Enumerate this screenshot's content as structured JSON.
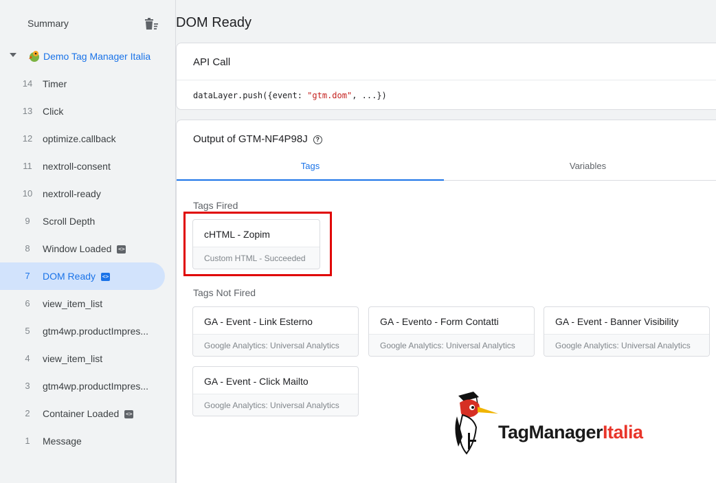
{
  "sidebar": {
    "summary_label": "Summary",
    "container_label": "Demo Tag Manager Italia",
    "events": [
      {
        "num": "14",
        "name": "Timer",
        "badge": false,
        "active": false
      },
      {
        "num": "13",
        "name": "Click",
        "badge": false,
        "active": false
      },
      {
        "num": "12",
        "name": "optimize.callback",
        "badge": false,
        "active": false
      },
      {
        "num": "11",
        "name": "nextroll-consent",
        "badge": false,
        "active": false
      },
      {
        "num": "10",
        "name": "nextroll-ready",
        "badge": false,
        "active": false
      },
      {
        "num": "9",
        "name": "Scroll Depth",
        "badge": false,
        "active": false
      },
      {
        "num": "8",
        "name": "Window Loaded",
        "badge": true,
        "active": false
      },
      {
        "num": "7",
        "name": "DOM Ready",
        "badge": true,
        "active": true
      },
      {
        "num": "6",
        "name": "view_item_list",
        "badge": false,
        "active": false
      },
      {
        "num": "5",
        "name": "gtm4wp.productImpres...",
        "badge": false,
        "active": false
      },
      {
        "num": "4",
        "name": "view_item_list",
        "badge": false,
        "active": false
      },
      {
        "num": "3",
        "name": "gtm4wp.productImpres...",
        "badge": false,
        "active": false
      },
      {
        "num": "2",
        "name": "Container Loaded",
        "badge": true,
        "active": false
      },
      {
        "num": "1",
        "name": "Message",
        "badge": false,
        "active": false
      }
    ]
  },
  "main": {
    "title": "DOM Ready",
    "api_call": {
      "title": "API Call",
      "code_prefix": "dataLayer.push({event: ",
      "code_string": "\"gtm.dom\"",
      "code_suffix": ", ...})"
    },
    "output": {
      "title": "Output of GTM-NF4P98J",
      "tabs": [
        {
          "label": "Tags",
          "active": true
        },
        {
          "label": "Variables",
          "active": false
        }
      ],
      "tags_fired_label": "Tags Fired",
      "tags_fired": [
        {
          "name": "cHTML - Zopim",
          "type": "Custom HTML - Succeeded"
        }
      ],
      "tags_not_fired_label": "Tags Not Fired",
      "tags_not_fired": [
        {
          "name": "GA - Event - Link Esterno",
          "type": "Google Analytics: Universal Analytics"
        },
        {
          "name": "GA - Evento - Form Contatti",
          "type": "Google Analytics: Universal Analytics"
        },
        {
          "name": "GA - Event - Banner Visibility",
          "type": "Google Analytics: Universal Analytics"
        },
        {
          "name": "GA - Event - Click Mailto",
          "type": "Google Analytics: Universal Analytics"
        }
      ]
    }
  },
  "brand": {
    "text_a": "TagManager",
    "text_b": "Italia",
    "color_a": "#1a1a1a",
    "color_b": "#e8352a"
  },
  "colors": {
    "accent": "#1a73e8",
    "active_bg": "#d2e3fc",
    "highlight": "#e00000"
  }
}
